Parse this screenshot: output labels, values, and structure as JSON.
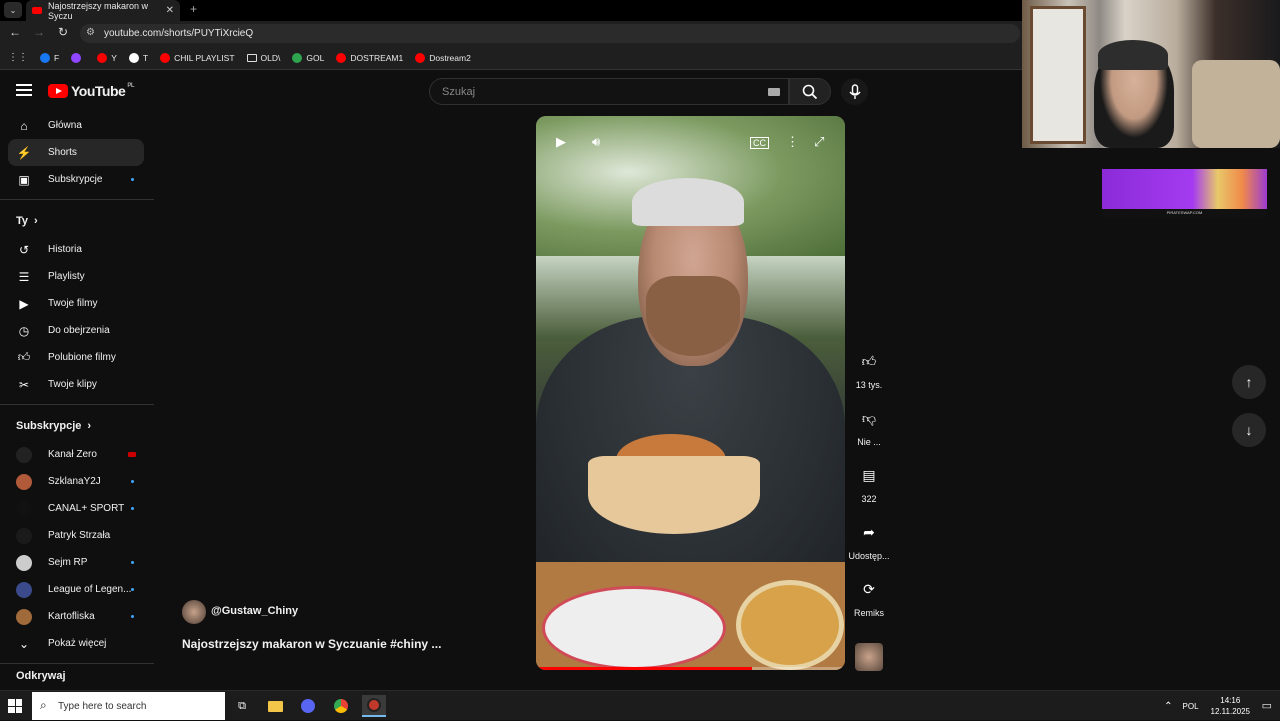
{
  "browser": {
    "tab_title": "Najostrzejszy makaron w Syczu",
    "url": "youtube.com/shorts/PUYTiXrcieQ",
    "bookmarks": [
      {
        "label": "F",
        "color": "#1877f2"
      },
      {
        "label": "",
        "color": "#9146ff"
      },
      {
        "label": "Y",
        "color": "#ff0000"
      },
      {
        "label": "T",
        "color": "#ffffff"
      },
      {
        "label": "CHIL PLAYLIST",
        "color": "#ff0000"
      },
      {
        "label": "OLD\\",
        "color": "folder"
      },
      {
        "label": "GOL",
        "color": "#2ea44f"
      },
      {
        "label": "DOSTREAM1",
        "color": "#ff0000"
      },
      {
        "label": "Dostream2",
        "color": "#ff0000"
      }
    ]
  },
  "youtube": {
    "logo_text": "YouTube",
    "logo_region": "PL",
    "search_placeholder": "Szukaj"
  },
  "sidebar": {
    "main": [
      {
        "label": "Główna",
        "icon": "home-icon"
      },
      {
        "label": "Shorts",
        "icon": "shorts-icon",
        "active": true
      },
      {
        "label": "Subskrypcje",
        "icon": "subscriptions-icon",
        "dot": true
      }
    ],
    "you_header": "Ty",
    "you": [
      {
        "label": "Historia",
        "icon": "history-icon"
      },
      {
        "label": "Playlisty",
        "icon": "playlist-icon"
      },
      {
        "label": "Twoje filmy",
        "icon": "your-videos-icon"
      },
      {
        "label": "Do obejrzenia",
        "icon": "watch-later-icon"
      },
      {
        "label": "Polubione filmy",
        "icon": "liked-icon"
      },
      {
        "label": "Twoje klipy",
        "icon": "scissors-icon"
      }
    ],
    "subs_header": "Subskrypcje",
    "subs": [
      {
        "label": "Kanał Zero",
        "avatar": "#222222",
        "badge": "live"
      },
      {
        "label": "SzklanaY2J",
        "avatar": "#b05a3a",
        "badge": "dot"
      },
      {
        "label": "CANAL+ SPORT",
        "avatar": "#111111",
        "badge": "dot"
      },
      {
        "label": "Patryk Strzała",
        "avatar": "#1a1a1a",
        "badge": ""
      },
      {
        "label": "Sejm RP",
        "avatar": "#cccccc",
        "badge": "dot"
      },
      {
        "label": "League of Legen...",
        "avatar": "#3a4a8a",
        "badge": "dot"
      },
      {
        "label": "Kartofliska",
        "avatar": "#a06a3a",
        "badge": "dot"
      }
    ],
    "show_more": "Pokaż więcej",
    "explore_partial": "Odkrywaj"
  },
  "short": {
    "channel": "@Gustaw_Chiny",
    "title": "Najostrzejszy makaron w Syczuanie  #chiny  ...",
    "progress": 0.7,
    "likes": "13 tys.",
    "dislike_label": "Nie ...",
    "comments": "322",
    "share_label": "Udostęp...",
    "remix_label": "Remiks"
  },
  "banner_text": "PIRATESWAP.COM",
  "taskbar": {
    "search_placeholder": "Type here to search",
    "lang": "POL",
    "time": "14:16",
    "date": "12.11.2025"
  }
}
